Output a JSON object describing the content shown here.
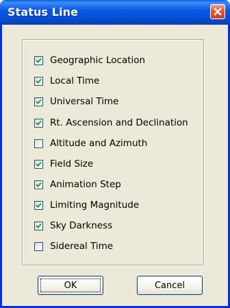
{
  "window": {
    "title": "Status Line",
    "close_icon": "close-icon"
  },
  "options": [
    {
      "label": "Geographic Location",
      "checked": true
    },
    {
      "label": "Local Time",
      "checked": true
    },
    {
      "label": "Universal Time",
      "checked": true
    },
    {
      "label": "Rt. Ascension and Declination",
      "checked": true
    },
    {
      "label": "Altitude and Azimuth",
      "checked": false
    },
    {
      "label": "Field Size",
      "checked": true
    },
    {
      "label": "Animation Step",
      "checked": true
    },
    {
      "label": "Limiting Magnitude",
      "checked": true
    },
    {
      "label": "Sky Darkness",
      "checked": true
    },
    {
      "label": "Sidereal Time",
      "checked": false
    }
  ],
  "buttons": {
    "ok_label": "OK",
    "cancel_label": "Cancel"
  },
  "colors": {
    "titlebar": "#0550d6",
    "close_button": "#e2552f",
    "dialog_background": "#ece9d8",
    "checkmark": "#21a121"
  }
}
